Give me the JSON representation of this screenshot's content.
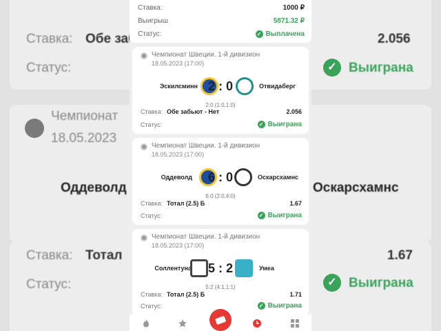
{
  "top": {
    "stake_label": "Ставка:",
    "stake_value": "1000 ₽",
    "win_label": "Выигрыш",
    "win_value": "5871.32 ₽",
    "status_label": "Статус:",
    "status_value": "Выплачена"
  },
  "background": {
    "stake_label": "Ставка:",
    "bet_partial": "Обе заб",
    "odds1": "2.056",
    "status_label": "Статус:",
    "status_value": "Выиграна",
    "champ_partial": "Чемпионат",
    "date_partial": "18.05.2023",
    "team_left_partial": "Оддеволд",
    "team_right_partial": "Оскарсхамнс",
    "bet2_partial": "Тотал",
    "odds2": "1.67",
    "status_value2": "Выиграна"
  },
  "matches": [
    {
      "championship": "Чемпионат Швеции. 1-й дивизион",
      "date": "18.05.2023 (17:00)",
      "home": "Эскилсминн",
      "away": "Отвидаберг",
      "score": "2 : 0",
      "halftime": "2:0 (1:0,1:0)",
      "stake_label": "Ставка:",
      "pick": "Обе забьют - Нет",
      "odds": "2.056",
      "status_label": "Статус:",
      "status": "Выиграна",
      "home_color": "#1f4fa0",
      "away_color": "#1f8f8f"
    },
    {
      "championship": "Чемпионат Швеции. 1-й дивизион",
      "date": "18.05.2023 (17:00)",
      "home": "Оддеволд",
      "away": "Оскарсхамнс",
      "score": "6 : 0",
      "halftime": "6:0 (2:0,4:0)",
      "stake_label": "Ставка:",
      "pick": "Тотал (2.5) Б",
      "odds": "1.67",
      "status_label": "Статус:",
      "status": "Выиграна",
      "home_color": "#1a4ea0",
      "away_color": "#333333"
    },
    {
      "championship": "Чемпионат Швеции. 1-й дивизион",
      "date": "18.05.2023 (17:00)",
      "home": "Соллентуна",
      "away": "Умеа",
      "score": "5 : 2",
      "halftime": "5:2 (4:1,1:1)",
      "stake_label": "Ставка:",
      "pick": "Тотал (2.5) Б",
      "odds": "1.71",
      "status_label": "Статус:",
      "status": "Выиграна",
      "home_color": "#444444",
      "away_color": "#3ab0c8"
    }
  ],
  "nav": {
    "items": [
      "fire-icon",
      "star-icon",
      "ticket-icon",
      "clock-icon",
      "grid-icon"
    ],
    "accent": "#e53935"
  },
  "colors": {
    "green": "#3aa35a",
    "red": "#e53935"
  }
}
